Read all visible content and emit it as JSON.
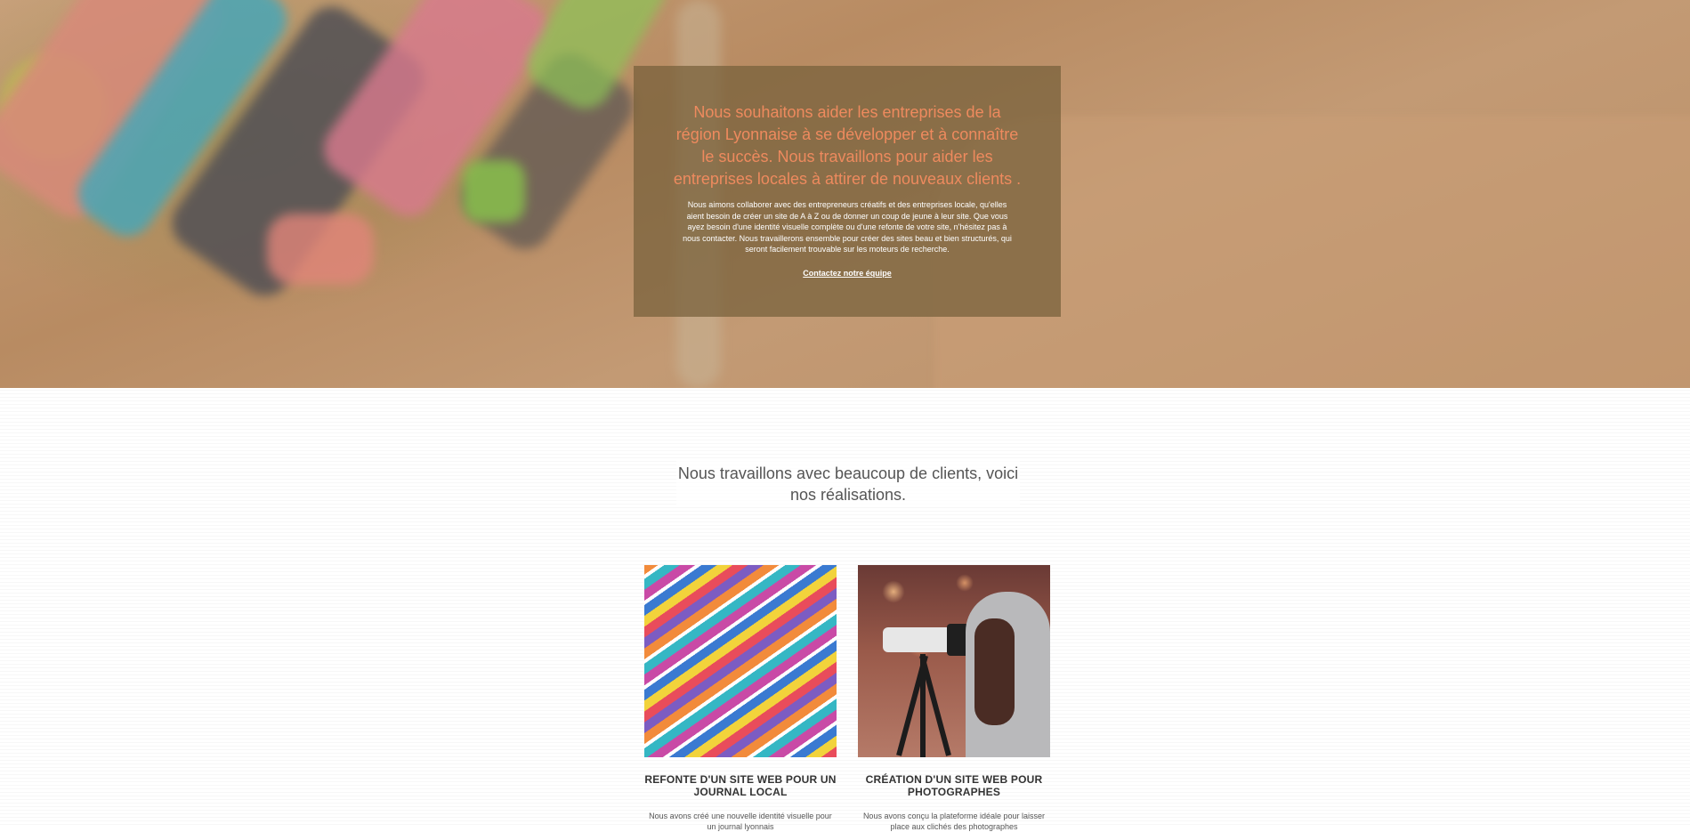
{
  "hero": {
    "headline": "Nous souhaitons aider les entreprises de la région Lyonnaise à se développer et à connaître le succès. Nous travaillons pour aider les entreprises locales à attirer de nouveaux clients .",
    "body": "Nous aimons collaborer avec des entrepreneurs créatifs et des entreprises locale, qu'elles aient besoin de créer un site de A à Z ou de donner un coup de jeune à leur site. Que vous ayez besoin d'une identité visuelle complète ou d'une refonte de votre site, n'hésitez pas à nous contacter. Nous travaillerons ensemble pour créer des sites beau et bien structurés, qui seront facilement trouvable sur les moteurs de recherche.",
    "cta_label": "Contactez notre équipe"
  },
  "work": {
    "title": "Nous travaillons avec beaucoup de clients, voici nos réalisations.",
    "projects": [
      {
        "title": "REFONTE D'UN SITE WEB POUR UN JOURNAL LOCAL",
        "description": "Nous avons créé une nouvelle identité visuelle pour un journal lyonnais",
        "image_icon": "magazines-image"
      },
      {
        "title": "CRÉATION D'UN SITE WEB POUR PHOTOGRAPHES",
        "description": "Nous avons conçu la plateforme idéale pour laisser place aux clichés des photographes",
        "image_icon": "photographer-image"
      }
    ]
  },
  "colors": {
    "headline_accent": "#ee8a5e",
    "overlay": "#76603a"
  }
}
